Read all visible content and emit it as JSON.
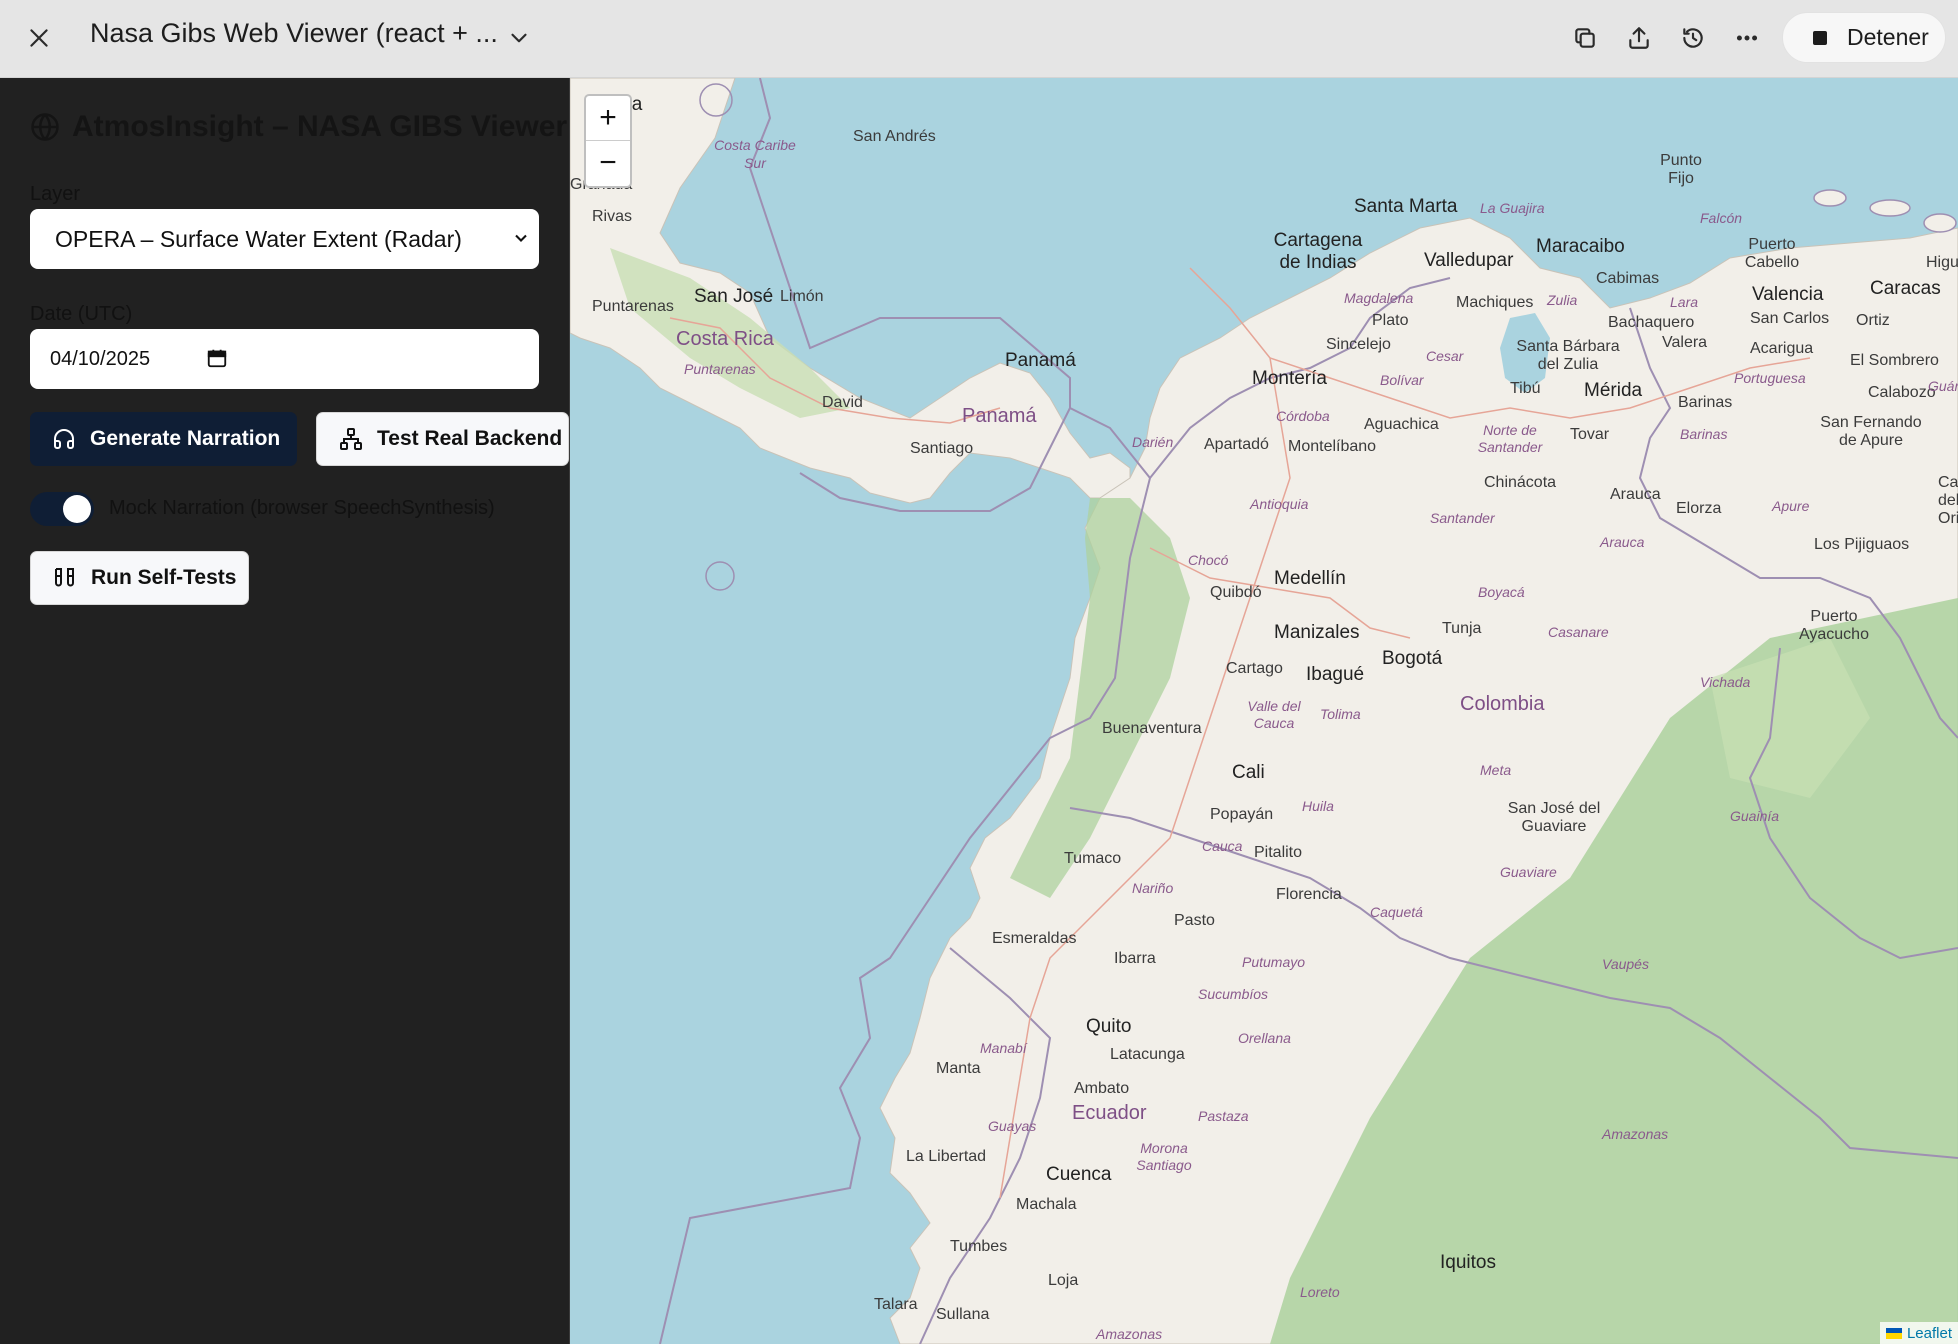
{
  "topbar": {
    "title": "Nasa Gibs Web Viewer (react + ...",
    "stop_label": "Detener"
  },
  "sidebar": {
    "app_title": "AtmosInsight – NASA GIBS Viewer",
    "layer_label": "Layer",
    "layer_value": "OPERA – Surface Water Extent (Radar)",
    "date_label": "Date (UTC)",
    "date_value": "04/10/2025",
    "generate_label": "Generate Narration",
    "test_backend_label": "Test Real Backend",
    "mock_label": "Mock Narration (browser SpeechSynthesis)",
    "mock_enabled": true,
    "self_test_label": "Run Self-Tests"
  },
  "map": {
    "zoom_in": "+",
    "zoom_out": "−",
    "attribution": "Leaflet",
    "places": {
      "nicaragua": "agua",
      "granada": "Granada",
      "rivas": "Rivas",
      "san_andres": "San Andrés",
      "costa_caribe_sur": "Costa Caribe Sur",
      "puntarenas": "Puntarenas",
      "san_jose": "San José",
      "limon": "Limón",
      "costa_rica": "Costa Rica",
      "puntarenas_region": "Puntarenas",
      "david": "David",
      "panama_city": "Panamá",
      "panama_country": "Panamá",
      "santiago": "Santiago",
      "darien": "Darién",
      "santa_marta": "Santa Marta",
      "la_guajira": "La Guajira",
      "punto_fijo": "Punto Fijo",
      "falcon": "Falcón",
      "cartagena": "Cartagena de Indias",
      "valledupar": "Valledupar",
      "maracaibo": "Maracaibo",
      "puerto_cabello": "Puerto Cabello",
      "cabimas": "Cabimas",
      "valencia": "Valencia",
      "caracas": "Caracas",
      "higuerote": "Higue",
      "magdalena": "Magdalena",
      "machiques": "Machiques",
      "zulia": "Zulia",
      "lara": "Lara",
      "san_carlos": "San Carlos",
      "ortiz": "Ortiz",
      "plato": "Plato",
      "bachaquero": "Bachaquero",
      "sincelejo": "Sincelejo",
      "santa_barbara": "Santa Bárbara del Zulia",
      "valera": "Valera",
      "acarigua": "Acarigua",
      "el_sombrero": "El Sombrero",
      "cesar": "Cesar",
      "monteria": "Montería",
      "bolivar": "Bolívar",
      "portuguesa": "Portuguesa",
      "calabozo": "Calabozo",
      "guarico": "Guáric",
      "tibu": "Tibú",
      "merida": "Mérida",
      "barinas_city": "Barinas",
      "cordoba": "Córdoba",
      "aguachica": "Aguachica",
      "norte_santander": "Norte de Santander",
      "tovar": "Tovar",
      "san_fernando": "San Fernando de Apure",
      "apartado": "Apartadó",
      "montelibano": "Montelíbano",
      "barinas_region": "Barinas",
      "chinacota": "Chinácota",
      "arauca_city": "Arauca",
      "elorza": "Elorza",
      "apure": "Apure",
      "caicara": "Caica del Ori",
      "antioquia": "Antioquia",
      "santander": "Santander",
      "los_pijiguaos": "Los Pijiguaos",
      "arauca_region": "Arauca",
      "choco": "Chocó",
      "quibdo": "Quibdó",
      "medellin": "Medellín",
      "boyaca": "Boyacá",
      "tunja": "Tunja",
      "casanare": "Casanare",
      "puerto_ayacucho": "Puerto Ayacucho",
      "manizales": "Manizales",
      "cartago": "Cartago",
      "ibague": "Ibagué",
      "bogota": "Bogotá",
      "vichada": "Vichada",
      "buenaventura": "Buenaventura",
      "valle_cauca": "Valle del Cauca",
      "tolima": "Tolima",
      "colombia": "Colombia",
      "cali": "Cali",
      "meta": "Meta",
      "huila": "Huila",
      "popayan": "Popayán",
      "san_jose_guaviare": "San José del Guaviare",
      "guainia": "Guainía",
      "cauca": "Cauca",
      "pitalito": "Pitalito",
      "tumaco": "Tumaco",
      "florencia": "Florencia",
      "guaviare": "Guaviare",
      "narino": "Nariño",
      "caqueta": "Caquetá",
      "pasto": "Pasto",
      "esmeraldas": "Esmeraldas",
      "ibarra": "Ibarra",
      "putumayo": "Putumayo",
      "vaupes": "Vaupés",
      "sucumbios": "Sucumbíos",
      "quito": "Quito",
      "orellana": "Orellana",
      "latacunga": "Latacunga",
      "manabi": "Manabí",
      "manta": "Manta",
      "ambato": "Ambato",
      "ecuador": "Ecuador",
      "pastaza": "Pastaza",
      "guayas": "Guayas",
      "amazonas_region": "Amazonas",
      "la_libertad": "La Libertad",
      "morona_santiago": "Morona Santiago",
      "cuenca": "Cuenca",
      "machala": "Machala",
      "tumbes": "Tumbes",
      "iquitos": "Iquitos",
      "loja": "Loja",
      "loreto": "Loreto",
      "talara": "Talara",
      "sullana": "Sullana",
      "amazonas_bottom": "Amazonas"
    }
  },
  "colors": {
    "sidebar_bg": "#212121",
    "button_dark": "#0f1e35",
    "water": "#aad3df",
    "land": "#f2efe9",
    "forest": "#add19e",
    "border": "#9e8fb2"
  }
}
